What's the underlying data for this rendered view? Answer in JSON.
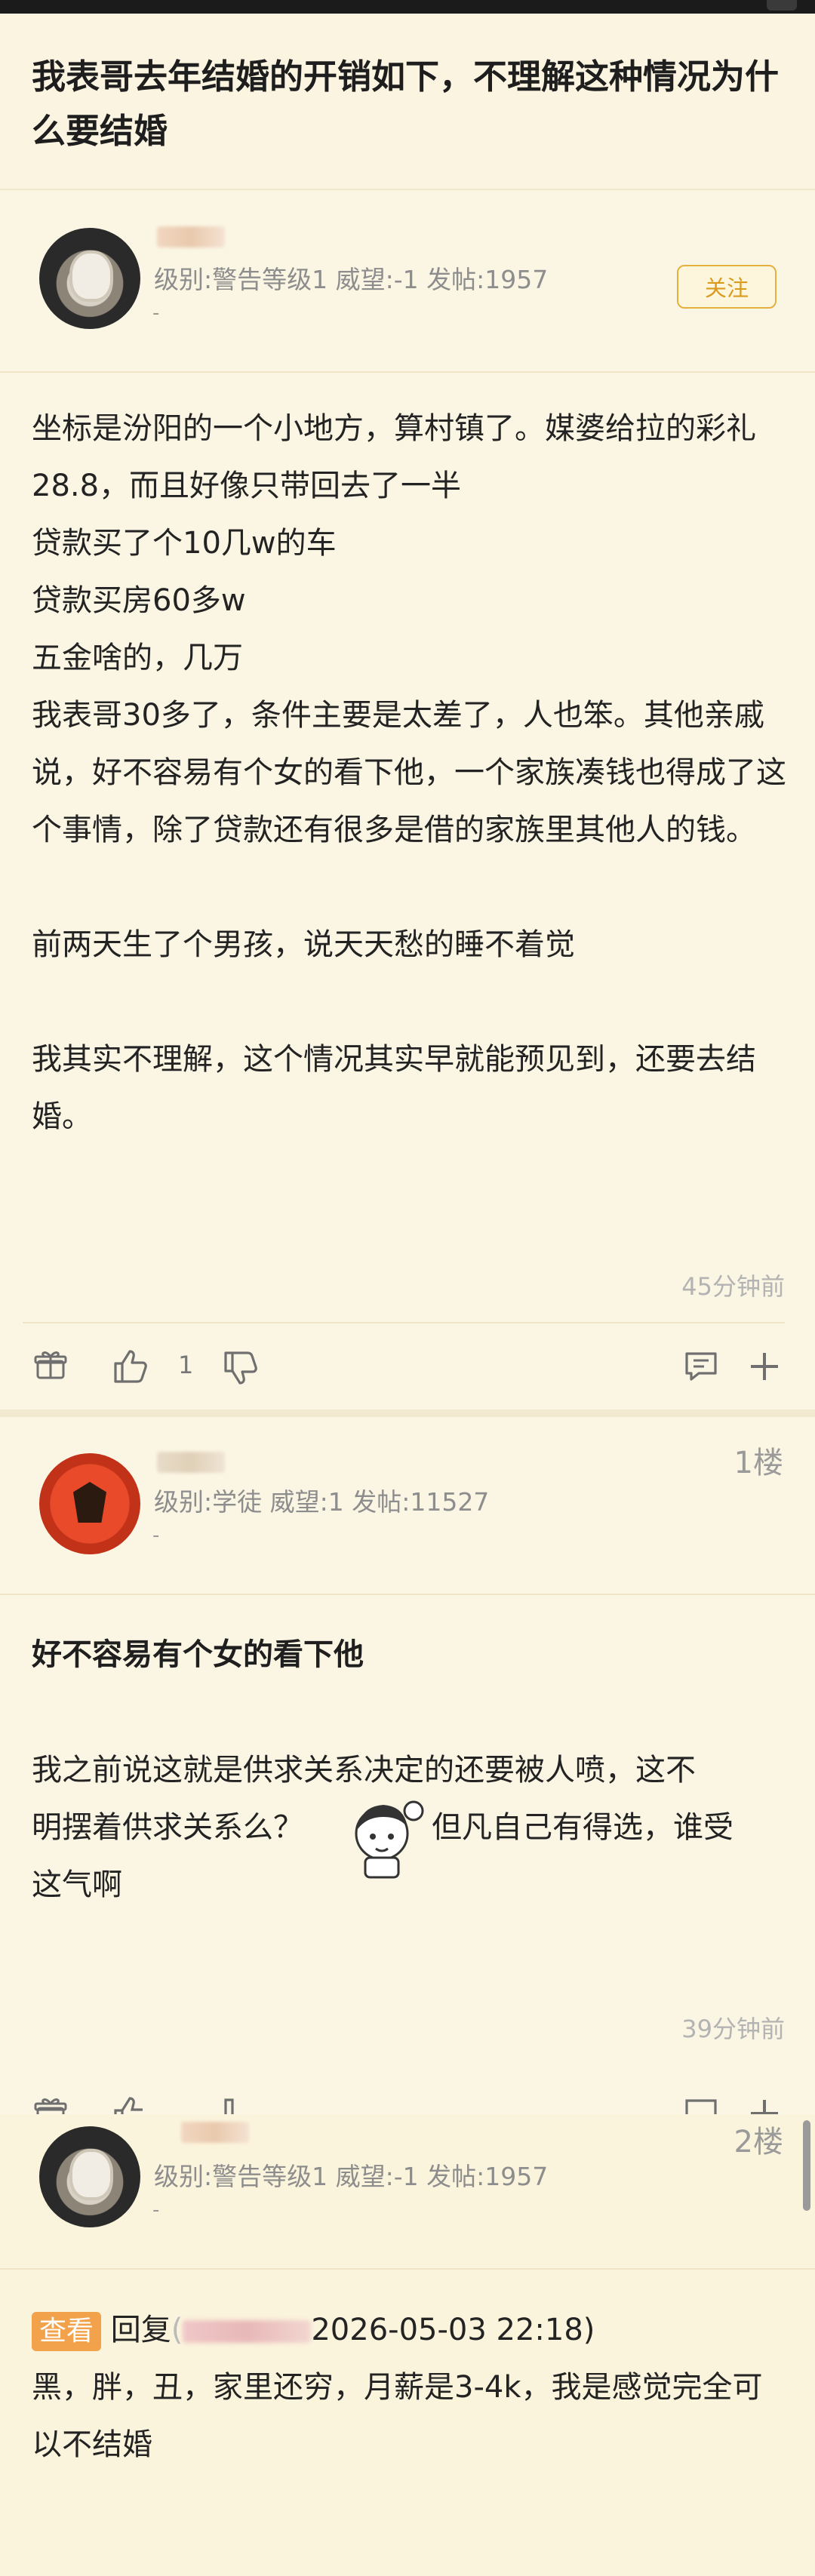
{
  "post": {
    "title": "我表哥去年结婚的开销如下，不理解这种情况为什么要结婚",
    "author_meta": "级别:警告等级1 威望:-1 发帖:1957",
    "follow_label": "关注",
    "dash": "-",
    "paragraphs": [
      "坐标是汾阳的一个小地方，算村镇了。媒婆给拉的彩礼28.8，而且好像只带回去了一半",
      "贷款买了个10几w的车",
      "贷款买房60多w",
      "五金啥的，几万",
      "我表哥30多了，条件主要是太差了，人也笨。其他亲戚说，好不容易有个女的看下他，一个家族凑钱也得成了这个事情，除了贷款还有很多是借的家族里其他人的钱。",
      "",
      "前两天生了个男孩，说天天愁的睡不着觉",
      "",
      "我其实不理解，这个情况其实早就能预见到，还要去结婚。"
    ],
    "time": "45分钟前",
    "like_count": "1"
  },
  "reply1": {
    "floor": "1楼",
    "author_meta": "级别:学徒 威望:1 发帖:11527",
    "dash": "-",
    "quote": "好不容易有个女的看下他",
    "text_line1": "我之前说这就是供求关系决定的还要被人喷，这不",
    "text_line2a": "明摆着供求关系么？",
    "text_line2b": "但凡自己有得选，谁受",
    "text_line3": "这气啊",
    "time": "39分钟前"
  },
  "reply2": {
    "floor": "2楼",
    "author_meta": "级别:警告等级1 威望:-1 发帖:1957",
    "dash": "-",
    "tag": "查看",
    "reply_prefix": "回复",
    "reply_date": "2026-05-03 22:18)",
    "text": "黑，胖，丑，家里还穷，月薪是3-4k，我是感觉完全可以不结婚"
  },
  "icons": {
    "gift": "gift-icon",
    "like": "thumbs-up-icon",
    "dislike": "thumbs-down-icon",
    "comment": "comment-icon",
    "plus": "plus-icon"
  }
}
